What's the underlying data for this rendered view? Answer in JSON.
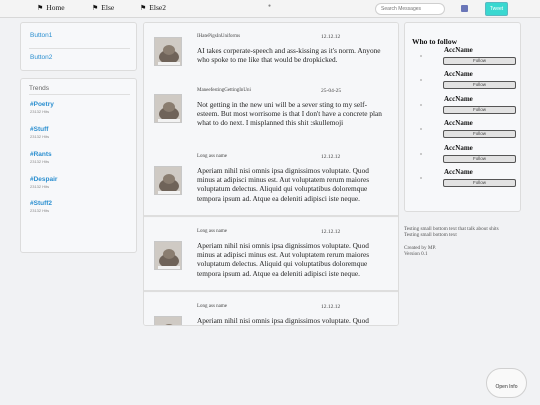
{
  "nav": {
    "home_label": "Home",
    "else_label": "Else",
    "else2_label": "Else2",
    "search_placeholder": "Search Messages",
    "tweet_label": "Tweet",
    "accent_color": "#39d8d0"
  },
  "menu": {
    "button1_label": "Button1",
    "button2_label": "Button2"
  },
  "trends": {
    "title": "Trends",
    "items": [
      {
        "tag": "#Poetry",
        "count": "23132 Hits"
      },
      {
        "tag": "#Stuff",
        "count": "23132 Hits"
      },
      {
        "tag": "#Rants",
        "count": "23132 Hits"
      },
      {
        "tag": "#Despair",
        "count": "23132 Hits"
      },
      {
        "tag": "#Stuff2",
        "count": "23132 Hits"
      }
    ]
  },
  "feed": {
    "posts": [
      {
        "author": "IHatePigsInUniforms",
        "date": "12.12.12",
        "text": "AI takes corperate-speech and ass-kissing as it's norm. Anyone who spoke to me like that would be dropkicked."
      },
      {
        "author": "ManeefestingGettingInUni",
        "date": "25-04-25",
        "text": "Not getting in the new uni will be a sever sting to my self-esteem. But most worrisome is that I don't have a concrete plan what to do next. I misplanned this shit :skullemoji"
      },
      {
        "author": "Long ass name",
        "date": "12.12.12",
        "text": "Aperiam nihil nisi omnis ipsa dignissimos voluptate. Quod minus at adipisci minus est. Aut voluptatem rerum maiores voluptatum delectus. Aliquid qui voluptatibus doloremque tempora ipsum ad. Atque ea deleniti adipisci iste neque."
      },
      {
        "author": "Long ass name",
        "date": "12.12.12",
        "text": "Aperiam nihil nisi omnis ipsa dignissimos voluptate. Quod minus at adipisci minus est. Aut voluptatem rerum maiores voluptatum delectus. Aliquid qui voluptatibus doloremque tempora ipsum ad. Atque ea deleniti adipisci iste neque."
      },
      {
        "author": "Long ass name",
        "date": "12.12.12",
        "text": "Aperiam nihil nisi omnis ipsa dignissimos voluptate. Quod minus at adipisci minus est. Aut voluptatem rerum maiores voluptatum delectus."
      }
    ]
  },
  "follow": {
    "title": "Who to follow",
    "button_label": "Follow",
    "items": [
      {
        "name": "AccName"
      },
      {
        "name": "AccName"
      },
      {
        "name": "AccName"
      },
      {
        "name": "AccName"
      },
      {
        "name": "AccName"
      },
      {
        "name": "AccName"
      }
    ]
  },
  "footer": {
    "line1": "Testing small bottom text that talk about shits",
    "line2": "Testing small bottom text",
    "created": "Created by MP.",
    "version": "Version 0.1"
  },
  "open_info_label": "Open Info"
}
